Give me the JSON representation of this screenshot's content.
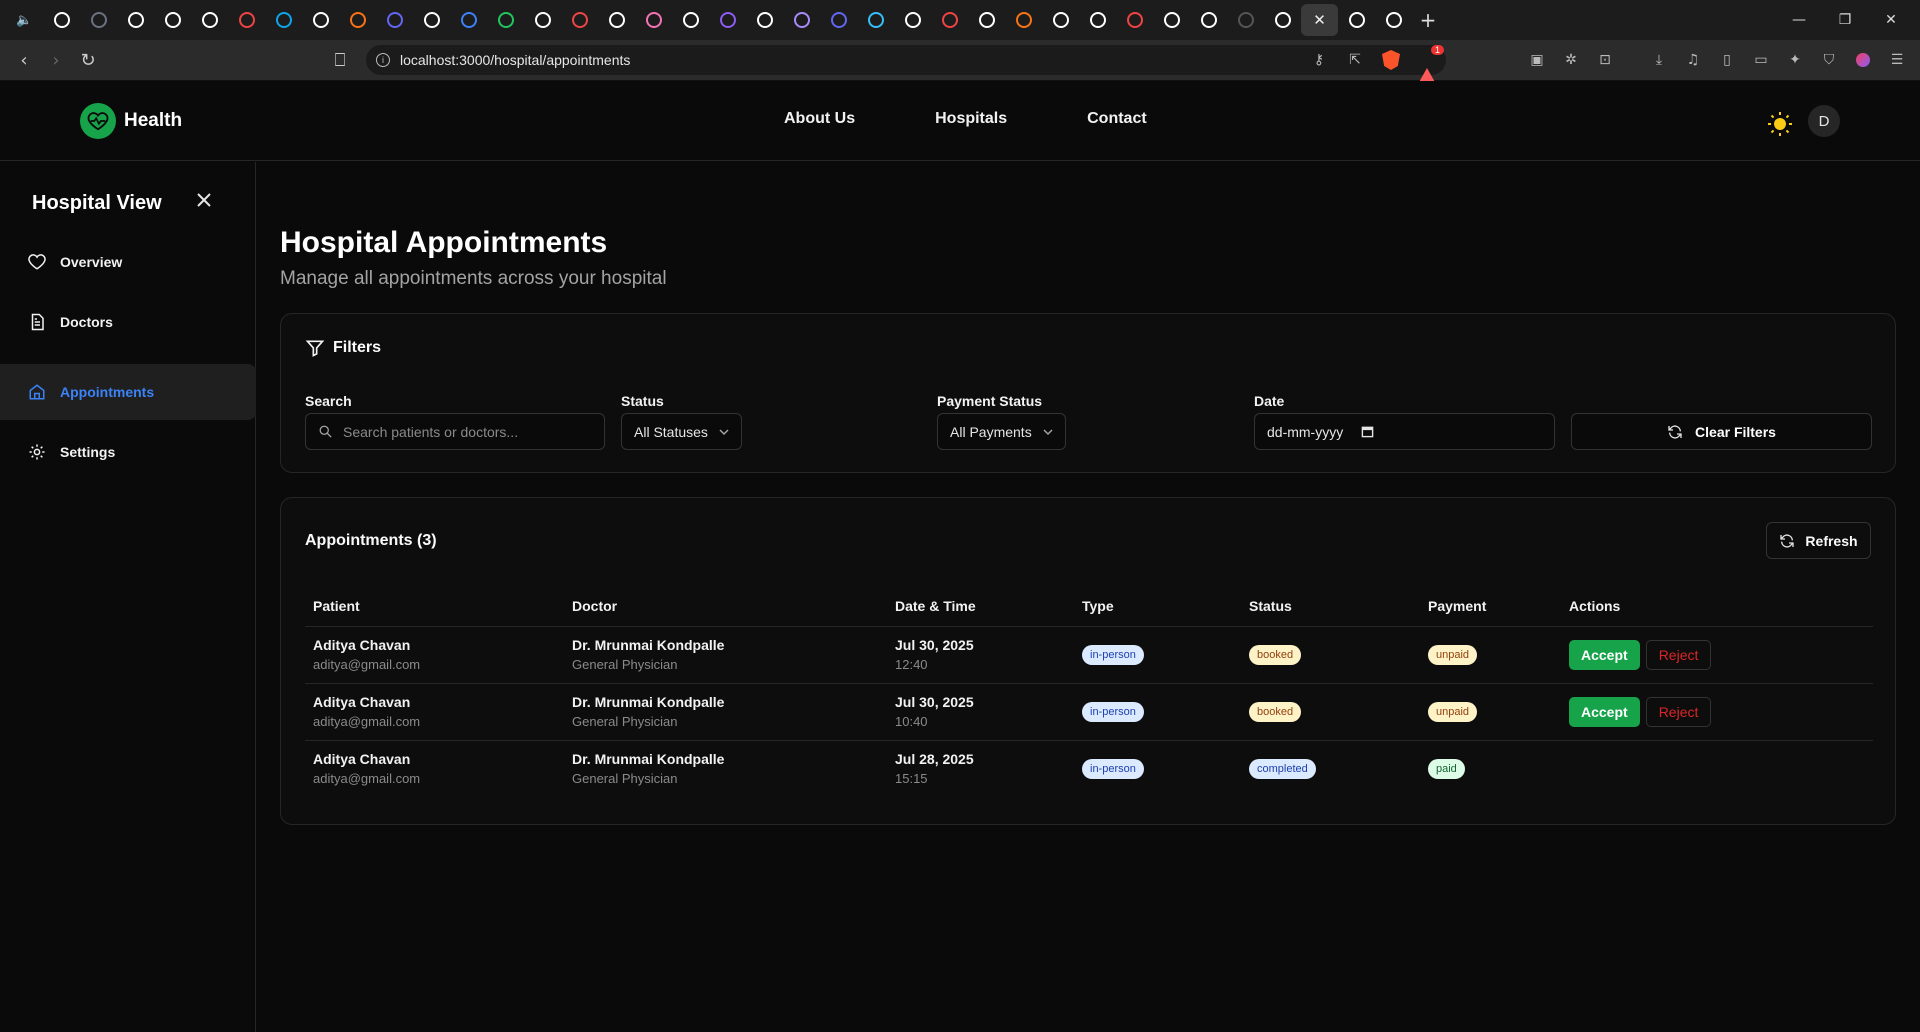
{
  "browser": {
    "url": "localhost:3000/hospital/appointments",
    "alert_count": "1"
  },
  "header": {
    "brand": "Health",
    "nav": [
      "About Us",
      "Hospitals",
      "Contact"
    ],
    "avatar_initial": "D"
  },
  "sidebar": {
    "title": "Hospital View",
    "items": [
      {
        "label": "Overview",
        "icon": "heart-icon"
      },
      {
        "label": "Doctors",
        "icon": "document-icon"
      },
      {
        "label": "Appointments",
        "icon": "home-icon",
        "active": true
      },
      {
        "label": "Settings",
        "icon": "gear-icon"
      }
    ]
  },
  "page": {
    "title": "Hospital Appointments",
    "subtitle": "Manage all appointments across your hospital"
  },
  "filters": {
    "heading": "Filters",
    "search_label": "Search",
    "search_placeholder": "Search patients or doctors...",
    "status_label": "Status",
    "status_value": "All Statuses",
    "payment_label": "Payment Status",
    "payment_value": "All Payments",
    "date_label": "Date",
    "date_placeholder": "dd-mm-yyyy",
    "clear_label": "Clear Filters"
  },
  "appointments": {
    "heading": "Appointments (3)",
    "refresh_label": "Refresh",
    "columns": [
      "Patient",
      "Doctor",
      "Date & Time",
      "Type",
      "Status",
      "Payment",
      "Actions"
    ],
    "accept_label": "Accept",
    "reject_label": "Reject",
    "rows": [
      {
        "patient": "Aditya Chavan",
        "email": "aditya@gmail.com",
        "doctor": "Dr. Mrunmai Kondpalle",
        "specialty": "General Physician",
        "date": "Jul 30, 2025",
        "time": "12:40",
        "type": "in-person",
        "status": "booked",
        "payment": "unpaid",
        "actions": true
      },
      {
        "patient": "Aditya Chavan",
        "email": "aditya@gmail.com",
        "doctor": "Dr. Mrunmai Kondpalle",
        "specialty": "General Physician",
        "date": "Jul 30, 2025",
        "time": "10:40",
        "type": "in-person",
        "status": "booked",
        "payment": "unpaid",
        "actions": true
      },
      {
        "patient": "Aditya Chavan",
        "email": "aditya@gmail.com",
        "doctor": "Dr. Mrunmai Kondpalle",
        "specialty": "General Physician",
        "date": "Jul 28, 2025",
        "time": "15:15",
        "type": "in-person",
        "status": "completed",
        "payment": "paid",
        "actions": false
      }
    ]
  },
  "colors": {
    "accent_green": "#16a34a",
    "active_blue": "#3b82f6",
    "reject_red": "#dc2626"
  }
}
